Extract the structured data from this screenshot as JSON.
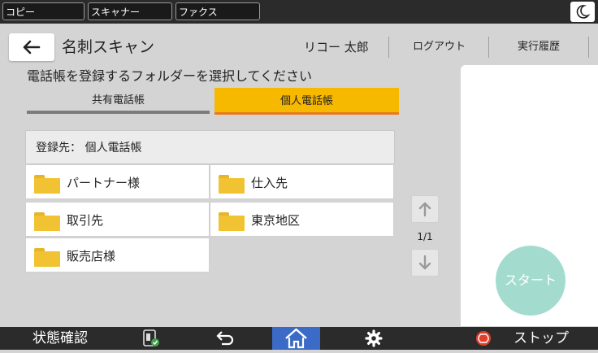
{
  "app_tabs": [
    {
      "label": "コピー"
    },
    {
      "label": "スキャナー"
    },
    {
      "label": "ファクス"
    }
  ],
  "header": {
    "title": "名刺スキャン",
    "user": "リコー 太郎",
    "logout_label": "ログアウト",
    "history_label": "実行履歴"
  },
  "instruction": "電話帳を登録するフォルダーを選択してください",
  "tabs": {
    "shared": "共有電話帳",
    "personal": "個人電話帳",
    "selected": "personal"
  },
  "destination_label": "登録先： 個人電話帳",
  "folders": [
    {
      "label": "パートナー様"
    },
    {
      "label": "仕入先"
    },
    {
      "label": "取引先"
    },
    {
      "label": "東京地区"
    },
    {
      "label": "販売店様"
    }
  ],
  "pagination": "1/1",
  "start_label": "スタート",
  "bottom": {
    "status_label": "状態確認",
    "stop_label": "ストップ"
  },
  "colors": {
    "selected_tab": "#f7b800",
    "folder": "#f1c232",
    "start_button": "#a3dccf",
    "home_button": "#3b6ac7",
    "stop_icon": "#e0402a"
  },
  "icons": [
    "moon-icon",
    "back-arrow-icon",
    "folder-icon",
    "arrow-up-icon",
    "arrow-down-icon",
    "device-status-icon",
    "return-icon",
    "home-icon",
    "gear-icon",
    "stop-icon"
  ]
}
